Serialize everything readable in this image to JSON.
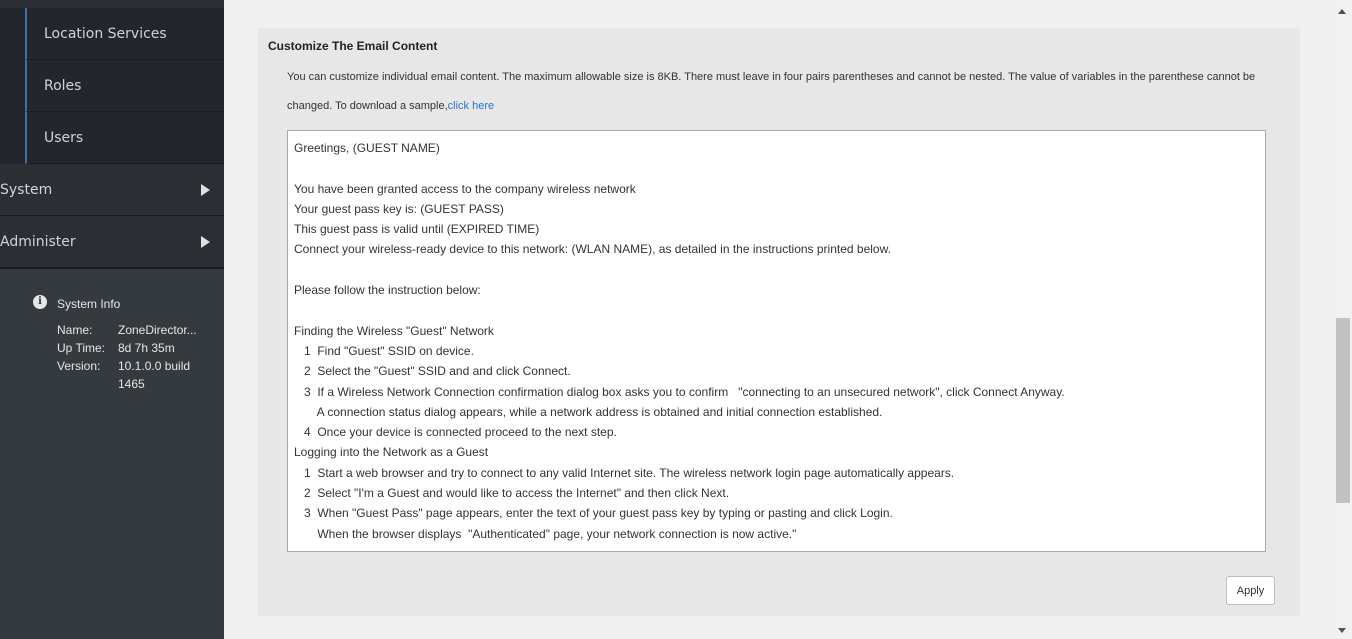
{
  "sidebar": {
    "sub_items": [
      {
        "label": "Location Services"
      },
      {
        "label": "Roles"
      },
      {
        "label": "Users"
      }
    ],
    "main_items": [
      {
        "label": "System"
      },
      {
        "label": "Administer"
      }
    ],
    "system_info": {
      "title": "System Info",
      "name_label": "Name:",
      "name_value": "ZoneDirector...",
      "uptime_label": "Up Time:",
      "uptime_value": "8d 7h 35m",
      "version_label": "Version:",
      "version_value_line1": "10.1.0.0 build",
      "version_value_line2": "1465"
    }
  },
  "panel": {
    "title": "Customize The Email Content",
    "description": "You can customize individual email content. The maximum allowable size is 8KB. There must leave in four pairs parentheses and cannot be nested. The value of variables in the parenthese cannot be changed. To download a sample,",
    "link_text": "click here",
    "email_lines": [
      "Greetings, (GUEST NAME)",
      "",
      "You have been granted access to the company wireless network",
      "Your guest pass key is: (GUEST PASS)",
      "This guest pass is valid until (EXPIRED TIME)",
      "Connect your wireless-ready device to this network: (WLAN NAME), as detailed in the instructions printed below.",
      "",
      "Please follow the instruction below:",
      "",
      "Finding the Wireless \"Guest\" Network",
      "   1  Find \"Guest\" SSID on device.",
      "   2  Select the \"Guest\" SSID and and click Connect.",
      "   3  If a Wireless Network Connection confirmation dialog box asks you to confirm   \"connecting to an unsecured network\", click Connect Anyway.",
      "       A connection status dialog appears, while a network address is obtained and initial connection established.",
      "   4  Once your device is connected proceed to the next step.",
      "Logging into the Network as a Guest",
      "   1  Start a web browser and try to connect to any valid Internet site. The wireless network login page automatically appears.",
      "   2  Select \"I'm a Guest and would like to access the Internet\" and then click Next.",
      "   3  When \"Guest Pass\" page appears, enter the text of your guest pass key by typing or pasting and click Login.",
      "       When the browser displays  \"Authenticated\" page, your network connection is now active.\""
    ],
    "apply_label": "Apply"
  }
}
